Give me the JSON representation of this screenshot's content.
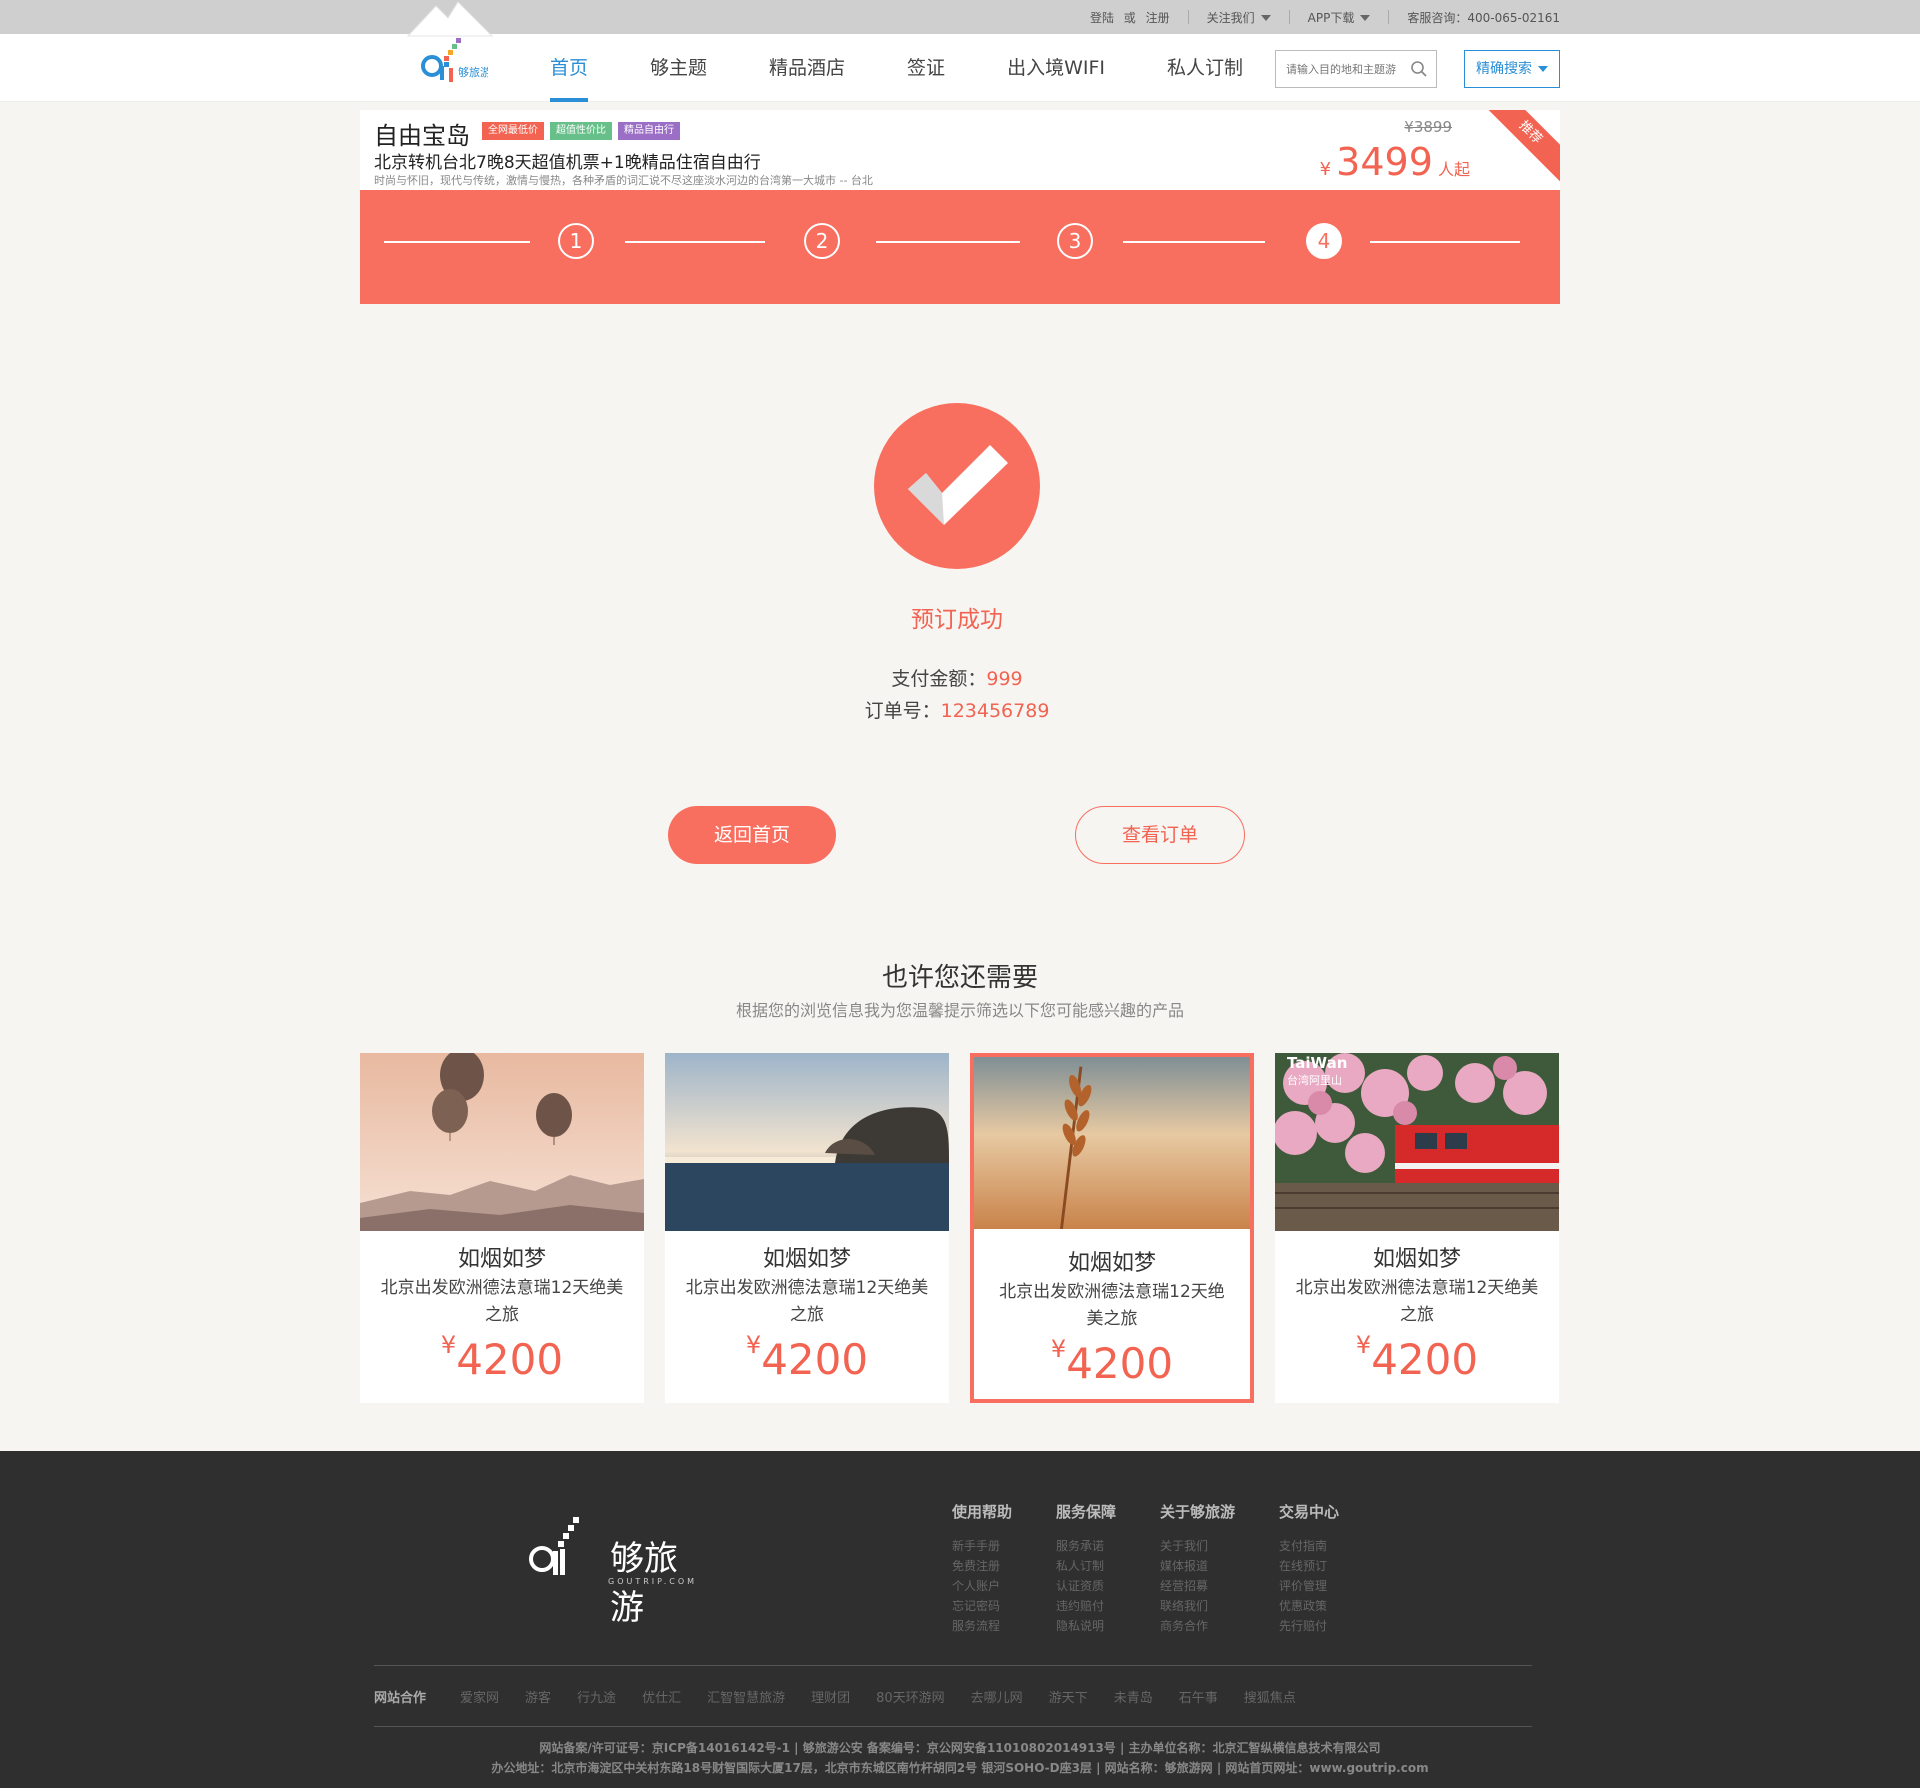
{
  "topbar": {
    "login": "登陆",
    "or": "或",
    "register": "注册",
    "follow": "关注我们",
    "app": "APP下载",
    "hotline": "客服咨询：400-065-02161"
  },
  "header": {
    "logo_text": "够旅游",
    "nav": [
      "首页",
      "够主题",
      "精品酒店",
      "签证",
      "出入境WIFI",
      "私人订制"
    ],
    "search_placeholder": "请输入目的地和主题游",
    "precise_search": "精确搜索"
  },
  "product": {
    "title": "自由宝岛",
    "tags": [
      {
        "label": "全网最低价",
        "color": "#f26351"
      },
      {
        "label": "超值性价比",
        "color": "#67c089"
      },
      {
        "label": "精品自由行",
        "color": "#9b6fc5"
      }
    ],
    "subtitle": "北京转机台北7晚8天超值机票+1晚精品住宿自由行",
    "description": "时尚与怀旧，现代与传统，激情与慢热，各种矛盾的词汇说不尽这座淡水河边的台湾第一大城市 -- 台北",
    "old_price": "¥3899",
    "currency": "¥",
    "price": "3499",
    "price_suffix": "人起",
    "ribbon": "推荐"
  },
  "steps": {
    "items": [
      "1",
      "2",
      "3",
      "4"
    ],
    "current": 4
  },
  "result": {
    "status": "预订成功",
    "pay_label": "支付金额：",
    "pay_value": "999",
    "order_label": "订单号：",
    "order_value": "123456789",
    "home_button": "返回首页",
    "order_button": "查看订单"
  },
  "recommend": {
    "title": "也许您还需要",
    "subtitle": "根据您的浏览信息我为您温馨提示筛选以下您可能感兴趣的产品",
    "cards": [
      {
        "name": "如烟如梦",
        "desc": "北京出发欧洲德法意瑞12天绝美之旅",
        "currency": "¥",
        "price": "4200",
        "image": "hot-air-balloons"
      },
      {
        "name": "如烟如梦",
        "desc": "北京出发欧洲德法意瑞12天绝美之旅",
        "currency": "¥",
        "price": "4200",
        "image": "infinity-pool-sunset"
      },
      {
        "name": "如烟如梦",
        "desc": "北京出发欧洲德法意瑞12天绝美之旅",
        "currency": "¥",
        "price": "4200",
        "image": "wheat-field"
      },
      {
        "name": "如烟如梦",
        "desc": "北京出发欧洲德法意瑞12天绝美之旅",
        "currency": "¥",
        "price": "4200",
        "image": "red-train-flowers",
        "overlay_title": "TaiWan",
        "overlay_sub": "台湾阿里山"
      }
    ]
  },
  "footer": {
    "logo_text": "够旅游",
    "logo_sub": "GOUTRIP.COM",
    "columns": [
      {
        "title": "使用帮助",
        "items": [
          "新手手册",
          "免费注册",
          "个人账户",
          "忘记密码",
          "服务流程"
        ]
      },
      {
        "title": "服务保障",
        "items": [
          "服务承诺",
          "私人订制",
          "认证资质",
          "违约赔付",
          "隐私说明"
        ]
      },
      {
        "title": "关于够旅游",
        "items": [
          "关于我们",
          "媒体报道",
          "经营招募",
          "联络我们",
          "商务合作"
        ]
      },
      {
        "title": "交易中心",
        "items": [
          "支付指南",
          "在线预订",
          "评价管理",
          "优惠政策",
          "先行赔付"
        ]
      }
    ],
    "partners_label": "网站合作",
    "partners": [
      "爱家网",
      "游客",
      "行九途",
      "优仕汇",
      "汇智智慧旅游",
      "理财团",
      "80天环游网",
      "去哪儿网",
      "游天下",
      "未青岛",
      "石午事",
      "搜狐焦点"
    ],
    "legal_1": "网站备案/许可证号：京ICP备14016142号-1 | 够旅游公安 备案编号：京公网安备11010802014913号 | 主办单位名称：北京汇智纵横信息技术有限公司",
    "legal_2": "办公地址：北京市海淀区中关村东路18号财智国际大厦17层，北京市东城区南竹杆胡同2号 银河SOHO-D座3层 | 网站名称：够旅游网 | 网站首页网址：www.goutrip.com"
  },
  "colors": {
    "accent": "#f96f5f",
    "price": "#f26351",
    "nav_active": "#2a8fd6",
    "footer_bg": "#2f2f2f"
  }
}
